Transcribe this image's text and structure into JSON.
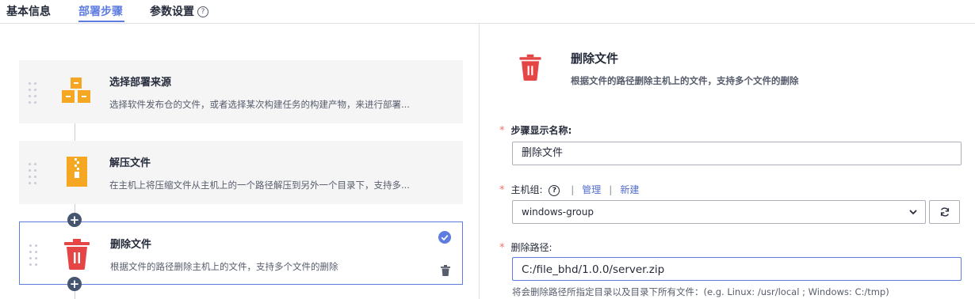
{
  "tabs": [
    {
      "label": "基本信息"
    },
    {
      "label": "部署步骤"
    },
    {
      "label": "参数设置"
    }
  ],
  "help_glyph": "?",
  "steps": [
    {
      "title": "选择部署来源",
      "desc": "选择软件发布仓的文件，或者选择某次构建任务的构建产物，来进行部署..."
    },
    {
      "title": "解压文件",
      "desc": "在主机上将压缩文件从主机上的一个路径解压到另外一个目录下，支持多..."
    },
    {
      "title": "删除文件",
      "desc": "根据文件的路径删除主机上的文件，支持多个文件的删除"
    }
  ],
  "add_glyph": "+",
  "detail": {
    "title": "删除文件",
    "desc": "根据文件的路径删除主机上的文件，支持多个文件的删除"
  },
  "form": {
    "required_mark": "*",
    "name_label": "步骤显示名称:",
    "name_value": "删除文件",
    "hostgroup_label": "主机组:",
    "manage_link": "管理",
    "separator": "|",
    "new_link": "新建",
    "hostgroup_value": "windows-group",
    "path_label": "删除路径:",
    "path_value": "C:/file_bhd/1.0.0/server.zip",
    "path_hint": "将会删除路径所指定目录以及目录下所有文件：(e.g. Linux: /usr/local ; Windows: C:/tmp)"
  },
  "colors": {
    "accent": "#5e7ce0",
    "required": "#f66f6a",
    "trash": "#e54545",
    "zip": "#f5a623"
  },
  "icons": [
    "grip-icon",
    "package-icon",
    "zip-icon",
    "trash-icon",
    "check-circle-icon",
    "chevron-down-icon",
    "refresh-icon",
    "help-icon"
  ]
}
